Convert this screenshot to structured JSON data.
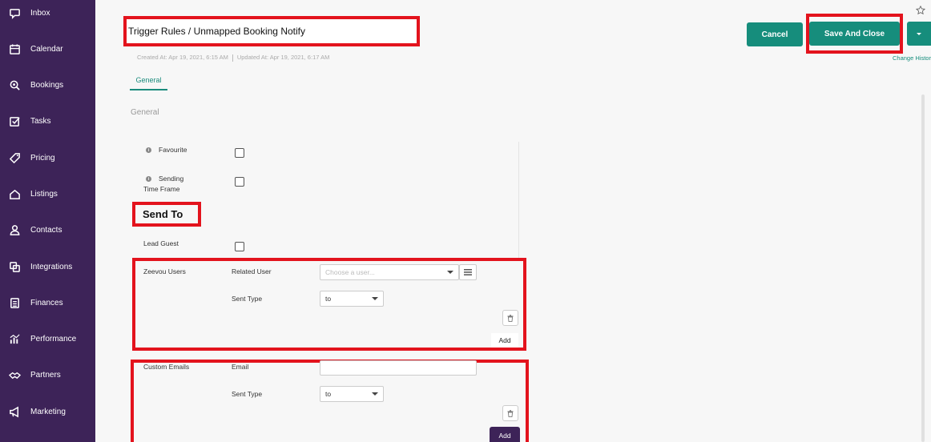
{
  "sidebar": {
    "items": [
      {
        "label": "Inbox",
        "icon": "inbox-icon"
      },
      {
        "label": "Calendar",
        "icon": "calendar-icon"
      },
      {
        "label": "Bookings",
        "icon": "bookings-icon"
      },
      {
        "label": "Tasks",
        "icon": "tasks-icon"
      },
      {
        "label": "Pricing",
        "icon": "pricing-tag-icon"
      },
      {
        "label": "Listings",
        "icon": "listings-home-icon"
      },
      {
        "label": "Contacts",
        "icon": "contacts-person-icon"
      },
      {
        "label": "Integrations",
        "icon": "integrations-icon"
      },
      {
        "label": "Finances",
        "icon": "finances-icon"
      },
      {
        "label": "Performance",
        "icon": "performance-chart-icon"
      },
      {
        "label": "Partners",
        "icon": "partners-handshake-icon"
      },
      {
        "label": "Marketing",
        "icon": "marketing-megaphone-icon"
      }
    ]
  },
  "header": {
    "title": "Trigger Rules / Unmapped Booking Notify",
    "created": "Created At: Apr 19, 2021, 6:15 AM",
    "updated": "Updated At: Apr 19, 2021, 6:17 AM",
    "cancel_label": "Cancel",
    "save_label": "Save And Close",
    "change_history": "Change History"
  },
  "tabs": [
    {
      "label": "General",
      "active": true
    }
  ],
  "form": {
    "section_title": "General",
    "favourite_label": "Favourite",
    "sending_time_frame_label_1": "Sending",
    "sending_time_frame_label_2": "Time Frame",
    "send_to_heading": "Send To",
    "lead_guest_label": "Lead Guest",
    "zeevou_users": {
      "label": "Zeevou Users",
      "related_user_label": "Related User",
      "user_placeholder": "Choose a user...",
      "sent_type_label": "Sent Type",
      "sent_type_value": "to",
      "add_label": "Add"
    },
    "custom_emails": {
      "label": "Custom Emails",
      "email_label": "Email",
      "email_value": "",
      "sent_type_label": "Sent Type",
      "sent_type_value": "to",
      "add_label": "Add"
    }
  },
  "colors": {
    "sidebar_bg": "#3d2358",
    "accent": "#168d7c",
    "highlight": "#e3131d"
  }
}
